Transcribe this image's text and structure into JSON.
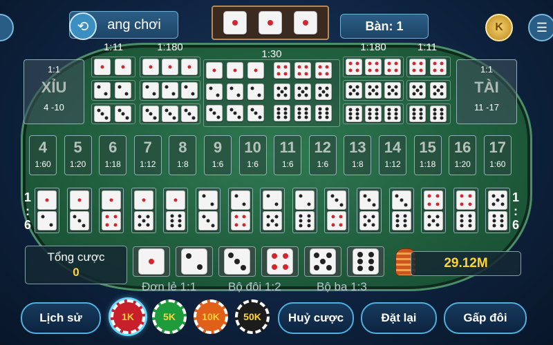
{
  "topbar": {
    "history_label": "ang chơi",
    "table_label": "Bàn: 1",
    "coin_letter": "K",
    "result_dice": [
      1,
      1,
      1
    ]
  },
  "ratios": {
    "single_left": "1:11",
    "triple_left": "1:180",
    "any_triple": "1:30",
    "triple_right": "1:180",
    "single_right": "1:11"
  },
  "small_box": {
    "ratio": "1:1",
    "label": "XỈU",
    "range": "4 -10"
  },
  "big_box": {
    "ratio": "1:1",
    "label": "TÀI",
    "range": "11 -17"
  },
  "sums": [
    {
      "n": "4",
      "odds": "1:60"
    },
    {
      "n": "5",
      "odds": "1:20"
    },
    {
      "n": "6",
      "odds": "1:18"
    },
    {
      "n": "7",
      "odds": "1:12"
    },
    {
      "n": "8",
      "odds": "1:8"
    },
    {
      "n": "9",
      "odds": "1:6"
    },
    {
      "n": "10",
      "odds": "1:6"
    },
    {
      "n": "11",
      "odds": "1:6"
    },
    {
      "n": "12",
      "odds": "1:6"
    },
    {
      "n": "13",
      "odds": "1:8"
    },
    {
      "n": "14",
      "odds": "1:12"
    },
    {
      "n": "15",
      "odds": "1:18"
    },
    {
      "n": "16",
      "odds": "1:20"
    },
    {
      "n": "17",
      "odds": "1:60"
    }
  ],
  "combo_side_ratio": {
    "left": "1\n:\n6",
    "right": "1\n:\n6"
  },
  "combos": [
    [
      1,
      2
    ],
    [
      1,
      3
    ],
    [
      1,
      4
    ],
    [
      1,
      5
    ],
    [
      1,
      6
    ],
    [
      2,
      3
    ],
    [
      2,
      4
    ],
    [
      2,
      5
    ],
    [
      2,
      6
    ],
    [
      3,
      4
    ],
    [
      3,
      5
    ],
    [
      3,
      6
    ],
    [
      4,
      5
    ],
    [
      4,
      6
    ],
    [
      5,
      6
    ]
  ],
  "total_bet": {
    "label": "Tổng cược",
    "value": "0"
  },
  "single_bet_dice": [
    1,
    2,
    3,
    4,
    5,
    6
  ],
  "balance": "29.12M",
  "bet_types": {
    "single": "Đơn lẻ 1:1",
    "double": "Bộ đôi 1:2",
    "triple": "Bộ ba 1:3"
  },
  "buttons": {
    "history": "Lịch sử",
    "cancel": "Huỷ cược",
    "reset": "Đặt lại",
    "double": "Gấp đôi"
  },
  "chips": [
    {
      "label": "1K",
      "color": "#c8202a",
      "text": "#ffd437",
      "selected": true
    },
    {
      "label": "5K",
      "color": "#1e9b3a",
      "text": "#ffd437",
      "selected": false
    },
    {
      "label": "10K",
      "color": "#e0601a",
      "text": "#ffd437",
      "selected": false
    },
    {
      "label": "50K",
      "color": "#1c1c1c",
      "text": "#ffd437",
      "selected": false
    }
  ]
}
